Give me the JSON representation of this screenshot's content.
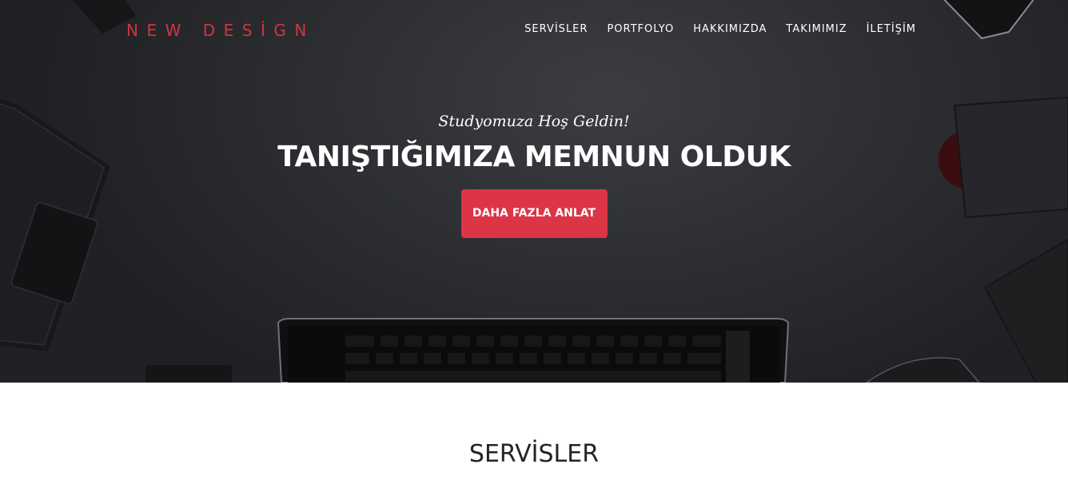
{
  "navbar": {
    "brand": "NEW DESİGN",
    "links": [
      {
        "label": "SERVİSLER"
      },
      {
        "label": "PORTFOLYO"
      },
      {
        "label": "HAKKIMIZDA"
      },
      {
        "label": "TAKIMIMIZ"
      },
      {
        "label": "İLETİŞİM"
      }
    ]
  },
  "hero": {
    "lead_in": "Studyomuza Hoş Geldin!",
    "heading": "TANIŞTIĞIMIZA MEMNUN OLDUK",
    "button_label": "DAHA FAZLA ANLAT"
  },
  "services": {
    "title": "SERVİSLER"
  },
  "colors": {
    "accent": "#dc3545",
    "brand": "#d3343f",
    "hero_dark": "#2e3034"
  }
}
